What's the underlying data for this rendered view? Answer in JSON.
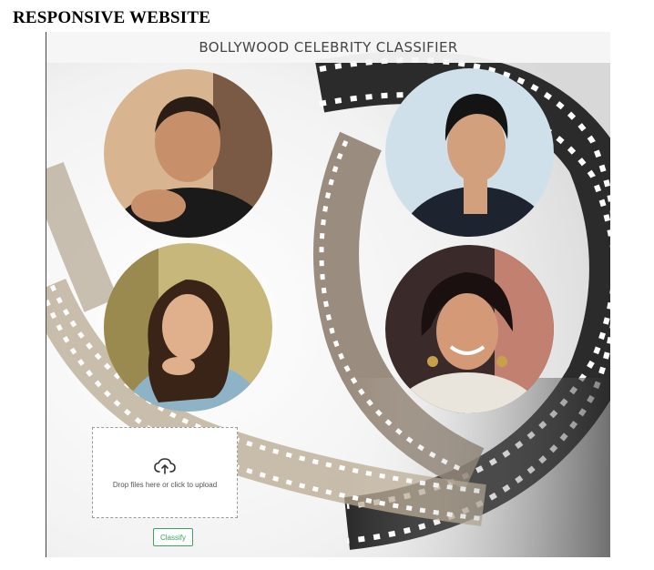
{
  "document": {
    "heading": "RESPONSIVE WEBSITE"
  },
  "navbar": {
    "title": "BOLLYWOOD CELEBRITY CLASSIFIER"
  },
  "celebrities": [
    {
      "shirt": "#1a1a1a",
      "skin": "#c8906a",
      "hair": "#2a1d16",
      "bg": "#d9b490"
    },
    {
      "shirt": "#1e2330",
      "skin": "#d3a07e",
      "hair": "#141414",
      "bg": "#cfe0ea"
    },
    {
      "shirt": "#8fb3c6",
      "skin": "#e0b08c",
      "hair": "#3a2418",
      "bg": "#c7b77a"
    },
    {
      "shirt": "#e9e4dc",
      "skin": "#d49a78",
      "hair": "#1a1010",
      "bg": "#3a2a2a"
    }
  ],
  "upload": {
    "icon": "cloud-upload-icon",
    "text": "Drop files here or click to upload"
  },
  "classify_button": {
    "label": "Classify",
    "color": "#3aa55b"
  }
}
